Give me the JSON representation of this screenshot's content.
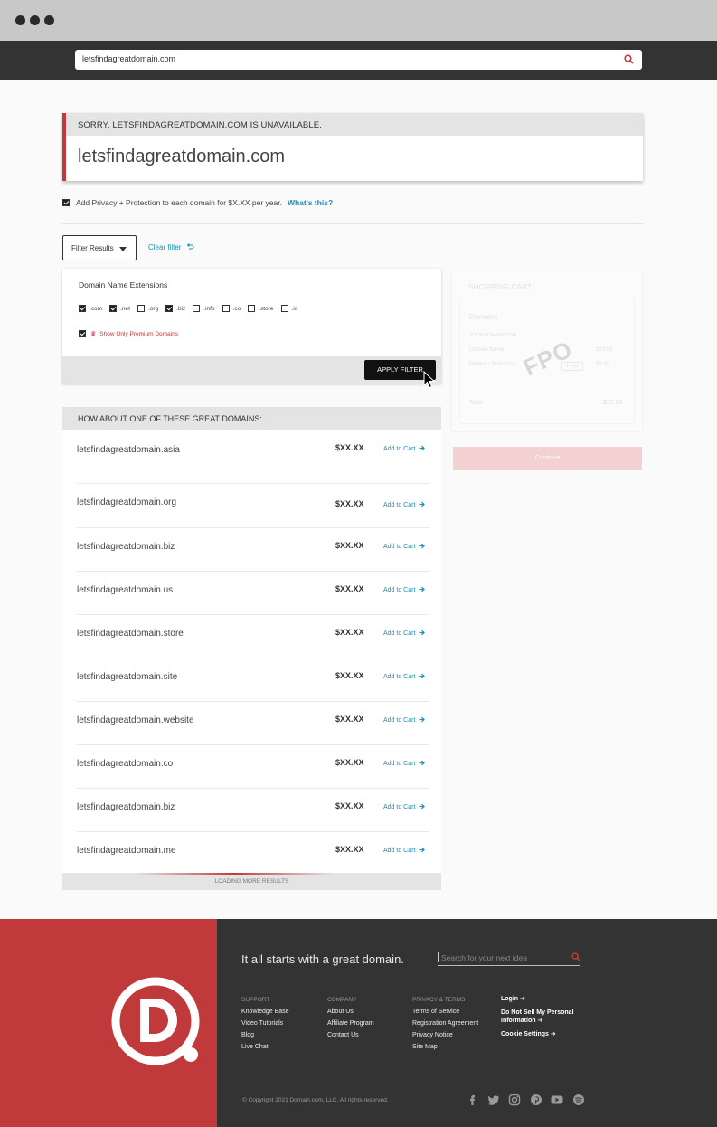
{
  "browser": {
    "url": "letsfindagreatdomain.com"
  },
  "unavailable": {
    "message": "SORRY, LETSFINDAGREATDOMAIN.COM IS UNAVAILABLE.",
    "domain": "letsfindagreatdomain.com"
  },
  "privacy": {
    "checked": true,
    "text": "Add Privacy + Protection to each domain for $X.XX per year.",
    "link": "What's this?"
  },
  "filter": {
    "button_label": "Filter Results",
    "clear_label": "Clear filter",
    "panel_title": "Domain Name Extensions",
    "extensions": [
      {
        "label": ".com",
        "checked": true
      },
      {
        "label": ".net",
        "checked": true
      },
      {
        "label": ".org",
        "checked": false
      },
      {
        "label": ".biz",
        "checked": true
      },
      {
        "label": ".info",
        "checked": false
      },
      {
        "label": ".co",
        "checked": false
      },
      {
        "label": ".store",
        "checked": false
      },
      {
        "label": ".io",
        "checked": false
      }
    ],
    "premium_label": "Show Only Premium Domains",
    "premium_checked": true,
    "apply_label": "APPLY FILTER"
  },
  "cart": {
    "title": "SHOPPING CART",
    "domains_label": "Domains",
    "domain_name": "YOURDOMAIN.COM",
    "line1_label": "Domain Name",
    "line1_price": "$19.99",
    "line2_label": "Privacy / Protection",
    "line2_price": "$9.99",
    "line2_term": "1 Year",
    "total_label": "Total",
    "total_price": "$27.98",
    "continue_label": "Continue",
    "fpo": "FPO"
  },
  "suggestions": {
    "header": "HOW ABOUT ONE OF THESE GREAT DOMAINS:",
    "add_label": "Add to Cart",
    "rows": [
      {
        "name": "letsfindagreatdomain.asia",
        "price": "$XX.XX"
      },
      {
        "name": "letsfindagreatdomain.org",
        "price": "$XX.XX"
      },
      {
        "name": "letsfindagreatdomain.biz",
        "price": "$XX.XX"
      },
      {
        "name": "letsfindagreatdomain.us",
        "price": "$XX.XX"
      },
      {
        "name": "letsfindagreatdomain.store",
        "price": "$XX.XX"
      },
      {
        "name": "letsfindagreatdomain.site",
        "price": "$XX.XX"
      },
      {
        "name": "letsfindagreatdomain.website",
        "price": "$XX.XX"
      },
      {
        "name": "letsfindagreatdomain.co",
        "price": "$XX.XX"
      },
      {
        "name": "letsfindagreatdomain.biz",
        "price": "$XX.XX"
      },
      {
        "name": "letsfindagreatdomain.me",
        "price": "$XX.XX"
      }
    ],
    "loading": "LOADING MORE RESULTS"
  },
  "footer": {
    "tagline": "It all starts with a great domain.",
    "search_placeholder": "Search for your next idea",
    "columns": [
      {
        "heading": "SUPPORT",
        "items": [
          "Knowledge Base",
          "Video Tutorials",
          "Blog",
          "Live Chat"
        ]
      },
      {
        "heading": "COMPANY",
        "items": [
          "About Us",
          "Affiliate Program",
          "Contact Us"
        ]
      },
      {
        "heading": "PRIVACY & TERMS",
        "items": [
          "Terms of Service",
          "Registration Agreement",
          "Privacy Notice",
          "Site Map"
        ]
      }
    ],
    "account_links": [
      "Login",
      "Do Not Sell My Personal Information",
      "Cookie Settings"
    ],
    "copyright": "© Copyright 2021 Domain.com, LLC. All rights reserved.",
    "socials": [
      "facebook-icon",
      "twitter-icon",
      "instagram-icon",
      "pinterest-icon",
      "youtube-icon",
      "spotify-icon"
    ]
  },
  "colors": {
    "brand_red": "#c0393b",
    "link_blue": "#1b8fb0",
    "dark": "#333333"
  }
}
